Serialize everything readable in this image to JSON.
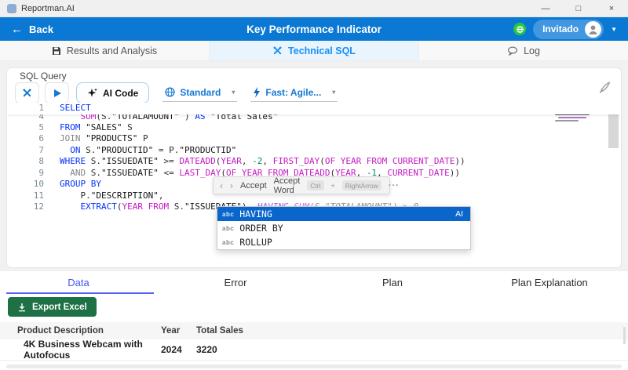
{
  "titlebar": {
    "app_name": "Reportman.AI",
    "minimize": "—",
    "maximize": "□",
    "close": "×"
  },
  "header": {
    "back_arrow": "←",
    "back_label": "Back",
    "title": "Key Performance Indicator",
    "user_label": "Invitado",
    "caret": "▼"
  },
  "main_tabs": [
    {
      "label": "Results and Analysis",
      "active": false
    },
    {
      "label": "Technical SQL",
      "active": true
    },
    {
      "label": "Log",
      "active": false
    }
  ],
  "sql": {
    "panel_title": "SQL Query",
    "toolbar": {
      "ai_code_label": "AI Code",
      "model_label": "Standard",
      "speed_label": "Fast: Agile...",
      "caret": "▾"
    },
    "editor": {
      "lines": [
        {
          "num": "1",
          "sticky": true,
          "tokens": [
            [
              "kw",
              "SELECT"
            ]
          ]
        },
        {
          "num": "4",
          "clip": true,
          "tokens": [
            [
              "pl",
              "    "
            ],
            [
              "fn",
              "SUM"
            ],
            [
              "pl",
              "(S."
            ],
            [
              "str",
              "\"TOTALAMOUNT\""
            ],
            [
              "pl",
              " ) "
            ],
            [
              "kw",
              "AS"
            ],
            [
              "pl",
              " "
            ],
            [
              "str",
              "\"Total Sales\""
            ]
          ]
        },
        {
          "num": "5",
          "tokens": [
            [
              "kw",
              "FROM"
            ],
            [
              "pl",
              " "
            ],
            [
              "str",
              "\"SALES\""
            ],
            [
              "pl",
              " S"
            ]
          ]
        },
        {
          "num": "6",
          "tokens": [
            [
              "kw2",
              "JOIN"
            ],
            [
              "pl",
              " "
            ],
            [
              "str",
              "\"PRODUCTS\""
            ],
            [
              "pl",
              " P"
            ]
          ]
        },
        {
          "num": "7",
          "tokens": [
            [
              "pl",
              "  "
            ],
            [
              "kw",
              "ON"
            ],
            [
              "pl",
              " S."
            ],
            [
              "str",
              "\"PRODUCTID\""
            ],
            [
              "op",
              " = "
            ],
            [
              "pl",
              "P."
            ],
            [
              "str",
              "\"PRODUCTID\""
            ]
          ]
        },
        {
          "num": "8",
          "tokens": [
            [
              "kw",
              "WHERE"
            ],
            [
              "pl",
              " S."
            ],
            [
              "str",
              "\"ISSUEDATE\""
            ],
            [
              "op",
              " >= "
            ],
            [
              "fn",
              "DATEADD"
            ],
            [
              "pl",
              "("
            ],
            [
              "fn",
              "YEAR"
            ],
            [
              "pl",
              ", "
            ],
            [
              "num",
              "-2"
            ],
            [
              "pl",
              ", "
            ],
            [
              "fn",
              "FIRST_DAY"
            ],
            [
              "pl",
              "("
            ],
            [
              "fn",
              "OF YEAR FROM CURRENT_DATE"
            ],
            [
              "pl",
              "))"
            ]
          ]
        },
        {
          "num": "9",
          "tokens": [
            [
              "pl",
              "  "
            ],
            [
              "kw2",
              "AND"
            ],
            [
              "pl",
              " S."
            ],
            [
              "str",
              "\"ISSUEDATE\""
            ],
            [
              "op",
              " <= "
            ],
            [
              "fn",
              "LAST_DAY"
            ],
            [
              "pl",
              "("
            ],
            [
              "fn",
              "OF YEAR FROM"
            ],
            [
              "pl",
              " "
            ],
            [
              "fn",
              "DATEADD"
            ],
            [
              "pl",
              "("
            ],
            [
              "fn",
              "YEAR"
            ],
            [
              "pl",
              ", "
            ],
            [
              "num",
              "-1"
            ],
            [
              "pl",
              ", "
            ],
            [
              "fn",
              "CURRENT_DATE"
            ],
            [
              "pl",
              "))"
            ]
          ]
        },
        {
          "num": "10",
          "tokens": [
            [
              "kw",
              "GROUP BY"
            ]
          ]
        },
        {
          "num": "11",
          "tokens": [
            [
              "pl",
              "    P."
            ],
            [
              "str",
              "\"DESCRIPTION\""
            ],
            [
              "pl",
              ","
            ]
          ]
        },
        {
          "num": "12",
          "tokens": [
            [
              "pl",
              "    "
            ],
            [
              "kw",
              "EXTRACT"
            ],
            [
              "pl",
              "("
            ],
            [
              "fn",
              "YEAR FROM"
            ],
            [
              "pl",
              " S."
            ],
            [
              "str",
              "\"ISSUEDATE\""
            ],
            [
              "pl",
              ")"
            ],
            [
              "gpl",
              "  "
            ],
            [
              "gkw",
              "HAVING"
            ],
            [
              "gfn",
              " SUM"
            ],
            [
              "gpl",
              "(S.\"TOTALAMOUNT\") > 0"
            ]
          ]
        }
      ],
      "suggest_bar": {
        "prev": "‹",
        "next": "›",
        "accept": "Accept",
        "accept_word": "Accept Word",
        "key_ctrl": "Ctrl",
        "plus": "+",
        "key_arrow": "RightArrow",
        "more": "···"
      },
      "autocomplete": {
        "icon_label": "abc",
        "items": [
          {
            "label": "HAVING",
            "badge": "AI",
            "selected": true
          },
          {
            "label": "ORDER BY"
          },
          {
            "label": "ROLLUP"
          }
        ]
      }
    }
  },
  "results": {
    "tabs": [
      {
        "label": "Data",
        "active": true
      },
      {
        "label": "Error",
        "active": false
      },
      {
        "label": "Plan",
        "active": false
      },
      {
        "label": "Plan Explanation",
        "active": false
      }
    ],
    "export_label": "Export Excel",
    "table": {
      "columns": [
        "Product Description",
        "Year",
        "Total Sales"
      ],
      "rows": [
        [
          "4K Business Webcam with Autofocus",
          "2024",
          "3220"
        ]
      ]
    }
  },
  "colors": {
    "header_blue": "#0b79d4",
    "active_tab_blue": "#1890f5",
    "excel_green": "#1e7145",
    "results_active_blue": "#4355f5",
    "autocomplete_selected": "#0a66cb"
  }
}
